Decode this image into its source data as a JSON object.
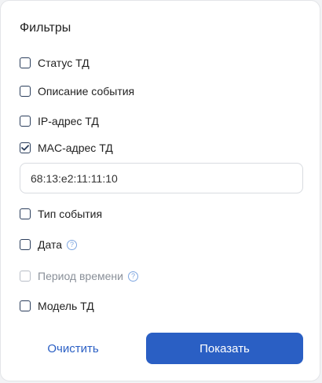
{
  "title": "Фильтры",
  "filters": [
    {
      "label": "Статус ТД",
      "checked": false,
      "disabled": false,
      "help": false
    },
    {
      "label": "Описание события",
      "checked": false,
      "disabled": false,
      "help": false
    },
    {
      "label": "IP-адрес ТД",
      "checked": false,
      "disabled": false,
      "help": false
    },
    {
      "label": "MAC-адрес ТД",
      "checked": true,
      "disabled": false,
      "help": false
    },
    {
      "label": "Тип события",
      "checked": false,
      "disabled": false,
      "help": false
    },
    {
      "label": "Дата",
      "checked": false,
      "disabled": false,
      "help": true
    },
    {
      "label": "Период времени",
      "checked": false,
      "disabled": true,
      "help": true
    },
    {
      "label": "Модель ТД",
      "checked": false,
      "disabled": false,
      "help": false
    }
  ],
  "mac_input": {
    "value": "68:13:e2:11:11:10"
  },
  "buttons": {
    "clear": "Очистить",
    "show": "Показать"
  },
  "colors": {
    "accent": "#2a5fc4",
    "help_icon": "#7ea6e0",
    "checkbox_border": "#2b3e5c"
  }
}
